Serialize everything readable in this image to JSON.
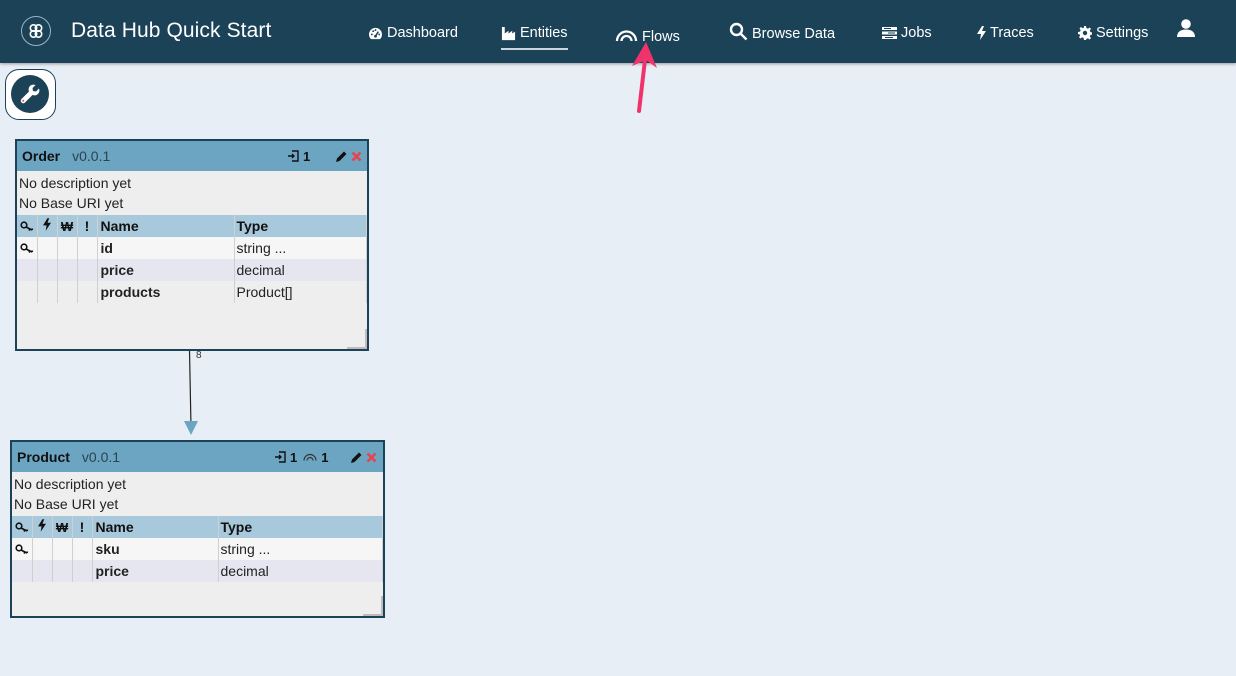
{
  "app": {
    "title": "Data Hub Quick Start"
  },
  "nav": {
    "items": [
      {
        "label": "Dashboard",
        "icon": "dashboard-icon",
        "active": false
      },
      {
        "label": "Entities",
        "icon": "factory-icon",
        "active": true
      },
      {
        "label": "Flows",
        "icon": "flows-icon",
        "active": false
      },
      {
        "label": "Browse Data",
        "icon": "search-icon",
        "active": false
      },
      {
        "label": "Jobs",
        "icon": "tasks-icon",
        "active": false
      },
      {
        "label": "Traces",
        "icon": "bolt-icon",
        "active": false
      },
      {
        "label": "Settings",
        "icon": "gear-icon",
        "active": false
      }
    ],
    "user_icon": "user-icon"
  },
  "toolbar": {
    "tool_icon": "wrench-icon"
  },
  "annotation": {
    "arrow_color": "#f0336b",
    "points_to": "Flows"
  },
  "colors": {
    "navbar": "#1b4257",
    "entity_header": "#6ba5c2",
    "table_header": "#a8c8dc",
    "delete": "#e8424f"
  },
  "entities": [
    {
      "name": "Order",
      "version": "v0.0.1",
      "input_count": "1",
      "flow_count": null,
      "description": "No description yet",
      "base_uri": "No Base URI yet",
      "columns": {
        "key": "key-icon",
        "elastic": "bolt-icon",
        "range": "won-icon",
        "required": "!",
        "name": "Name",
        "type": "Type"
      },
      "properties": [
        {
          "name": "id",
          "type": "string ...",
          "primary_key": true
        },
        {
          "name": "price",
          "type": "decimal",
          "primary_key": false
        },
        {
          "name": "products",
          "type": "Product[]",
          "primary_key": false
        }
      ]
    },
    {
      "name": "Product",
      "version": "v0.0.1",
      "input_count": "1",
      "flow_count": "1",
      "description": "No description yet",
      "base_uri": "No Base URI yet",
      "columns": {
        "key": "key-icon",
        "elastic": "bolt-icon",
        "range": "won-icon",
        "required": "!",
        "name": "Name",
        "type": "Type"
      },
      "properties": [
        {
          "name": "sku",
          "type": "string ...",
          "primary_key": true
        },
        {
          "name": "price",
          "type": "decimal",
          "primary_key": false
        }
      ]
    }
  ],
  "connector": {
    "label": "8",
    "from": "Order",
    "to": "Product"
  }
}
